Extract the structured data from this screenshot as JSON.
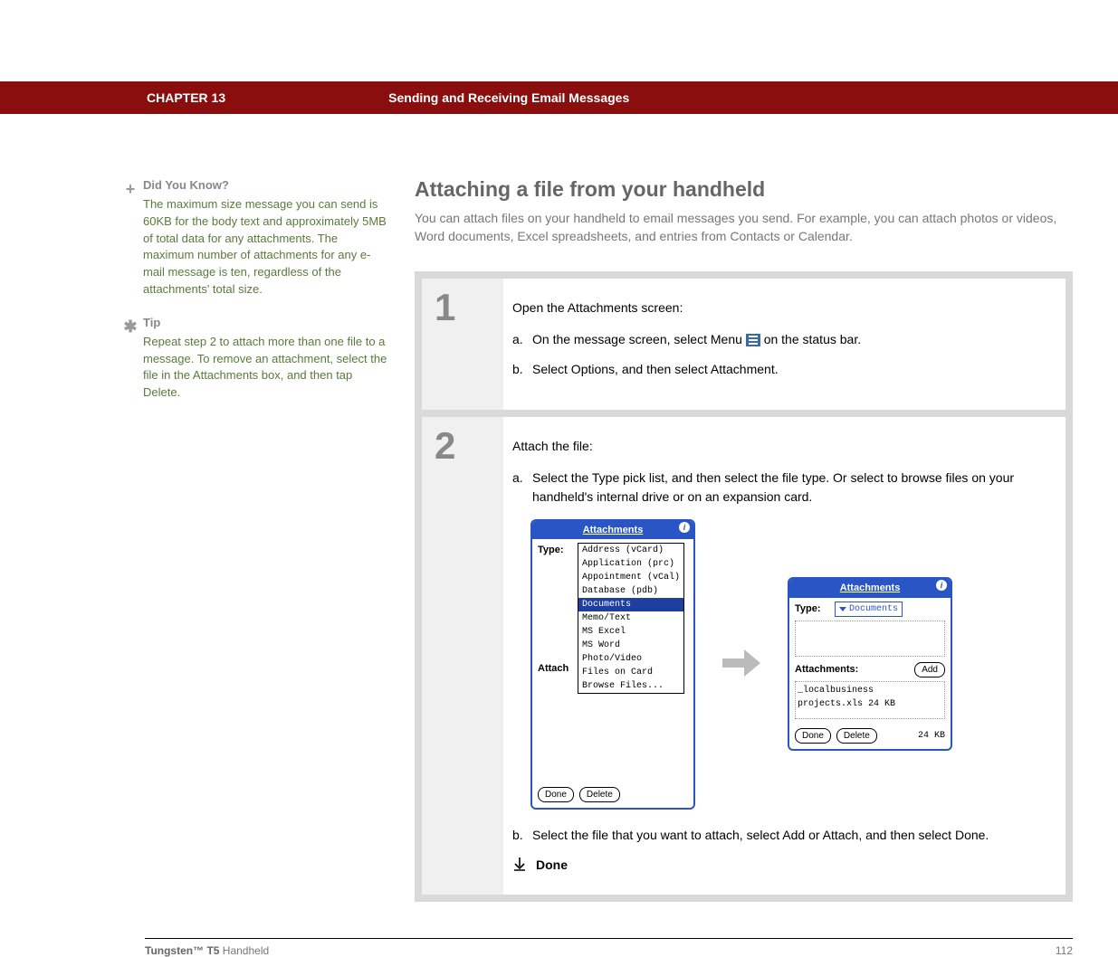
{
  "header": {
    "chapter": "CHAPTER 13",
    "title": "Sending and Receiving Email Messages"
  },
  "sidebar": {
    "didyouknow": {
      "heading": "Did You Know?",
      "text": "The maximum size message you can send is 60KB for the body text and approximately 5MB of total data for any attachments. The maximum number of attachments for any e-mail message is ten, regardless of the attachments' total size."
    },
    "tip": {
      "heading": "Tip",
      "text": "Repeat step 2 to attach more than one file to a message. To remove an attachment, select the file in the Attachments box, and then tap Delete."
    }
  },
  "main": {
    "title": "Attaching a file from your handheld",
    "intro": "You can attach files on your handheld to email messages you send. For example, you can attach photos or videos, Word documents, Excel spreadsheets, and entries from Contacts or Calendar."
  },
  "steps": {
    "s1": {
      "num": "1",
      "lead": "Open the Attachments screen:",
      "a_letter": "a.",
      "a_pre": "On the message screen, select Menu ",
      "a_post": " on the status bar.",
      "b_letter": "b.",
      "b": "Select Options, and then select Attachment."
    },
    "s2": {
      "num": "2",
      "lead": "Attach the file:",
      "a_letter": "a.",
      "a": "Select the Type pick list, and then select the file type. Or select to browse files on your handheld's internal drive or on an expansion card.",
      "b_letter": "b.",
      "b": "Select the file that you want to attach, select Add or Attach, and then select Done.",
      "done": "Done"
    }
  },
  "mock": {
    "title": "Attachments",
    "type_label": "Type:",
    "att_label": "Attachments:",
    "attach_short": "Attach",
    "options": {
      "o0": "Address (vCard)",
      "o1": "Application (prc)",
      "o2": "Appointment (vCal)",
      "o3": "Database (pdb)",
      "o4": "Documents",
      "o5": "Memo/Text",
      "o6": "MS Excel",
      "o7": "MS Word",
      "o8": "Photo/Video",
      "o9": "Files on Card",
      "o10": "Browse Files..."
    },
    "selected_type": "Documents",
    "add_btn": "Add",
    "done_btn": "Done",
    "delete_btn": "Delete",
    "file_entry": "_localbusiness projects.xls  24 KB",
    "total_size": "24 KB"
  },
  "footer": {
    "model_bold": "Tungsten™ T5",
    "model_rest": " Handheld",
    "page": "112"
  }
}
